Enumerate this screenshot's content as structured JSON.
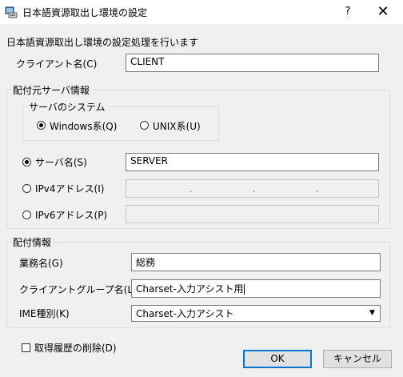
{
  "window": {
    "title": "日本語資源取出し環境の設定",
    "help": "?",
    "close": "✕"
  },
  "intro": "日本語資源取出し環境の設定処理を行います",
  "client": {
    "label": "クライアント名(C)",
    "value": "CLIENT"
  },
  "source_group": {
    "title": "配付元サーバ情報",
    "system_group": {
      "title": "サーバのシステム",
      "windows": "Windows系(Q)",
      "unix": "UNIX系(U)",
      "selected": "windows"
    },
    "server_name": {
      "label": "サーバ名(S)",
      "value": "SERVER",
      "selected": true
    },
    "ipv4": {
      "label": "IPv4アドレス(I)",
      "dots": [
        ".",
        ".",
        "."
      ]
    },
    "ipv6": {
      "label": "IPv6アドレス(P)"
    }
  },
  "dist_group": {
    "title": "配付情報",
    "business": {
      "label": "業務名(G)",
      "value": "総務"
    },
    "client_group": {
      "label": "クライアントグループ名(L)",
      "value": "Charset-入力アシスト用"
    },
    "ime": {
      "label": "IME種別(K)",
      "value": "Charset-入力アシスト",
      "arrow": "▼"
    }
  },
  "delete_history": {
    "label": "取得履歴の削除(D)",
    "checked": false
  },
  "buttons": {
    "ok": "OK",
    "cancel": "キャンセル"
  }
}
